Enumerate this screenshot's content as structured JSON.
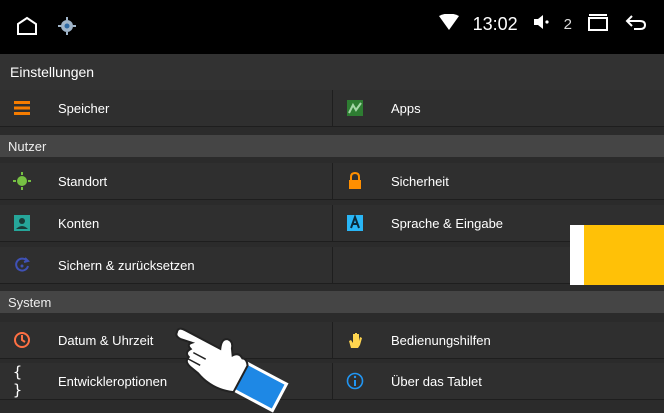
{
  "statusbar": {
    "time": "13:02",
    "volume_level": "2",
    "icons": [
      "home-icon",
      "settings-gear-icon",
      "wifi-icon",
      "volume-icon",
      "recent-apps-icon",
      "back-icon"
    ]
  },
  "title": "Einstellungen",
  "rows": [
    {
      "left": {
        "label": "Speicher",
        "icon": "storage-icon"
      },
      "right": {
        "label": "Apps",
        "icon": "apps-icon"
      }
    }
  ],
  "sections": {
    "nutzer": "Nutzer",
    "system": "System"
  },
  "nutzer_rows": [
    {
      "left": {
        "label": "Standort",
        "icon": "location-icon"
      },
      "right": {
        "label": "Sicherheit",
        "icon": "lock-icon"
      }
    },
    {
      "left": {
        "label": "Konten",
        "icon": "account-icon"
      },
      "right": {
        "label": "Sprache & Eingabe",
        "icon": "language-icon"
      }
    },
    {
      "left": {
        "label": "Sichern & zurücksetzen",
        "icon": "backup-icon"
      },
      "right": {
        "label": "",
        "icon": ""
      }
    }
  ],
  "system_rows": [
    {
      "left": {
        "label": "Datum & Uhrzeit",
        "icon": "clock-icon"
      },
      "right": {
        "label": "Bedienungshilfen",
        "icon": "accessibility-hand-icon"
      }
    },
    {
      "left": {
        "label": "Entwickleroptionen",
        "icon": "braces-icon"
      },
      "right": {
        "label": "Über das Tablet",
        "icon": "info-icon"
      }
    }
  ],
  "colors": {
    "accent_yellow": "#ffc107",
    "storage_orange": "#f57c00",
    "apps_green": "#2e7d32",
    "location_green": "#76c043",
    "lock_orange": "#ff8f00",
    "account_teal": "#26a69a",
    "language_blue": "#29b6f6",
    "backup_blue": "#3f51b5",
    "clock_orange": "#ff7043",
    "hand_yellow": "#ffd54f",
    "info_blue": "#2196f3"
  }
}
